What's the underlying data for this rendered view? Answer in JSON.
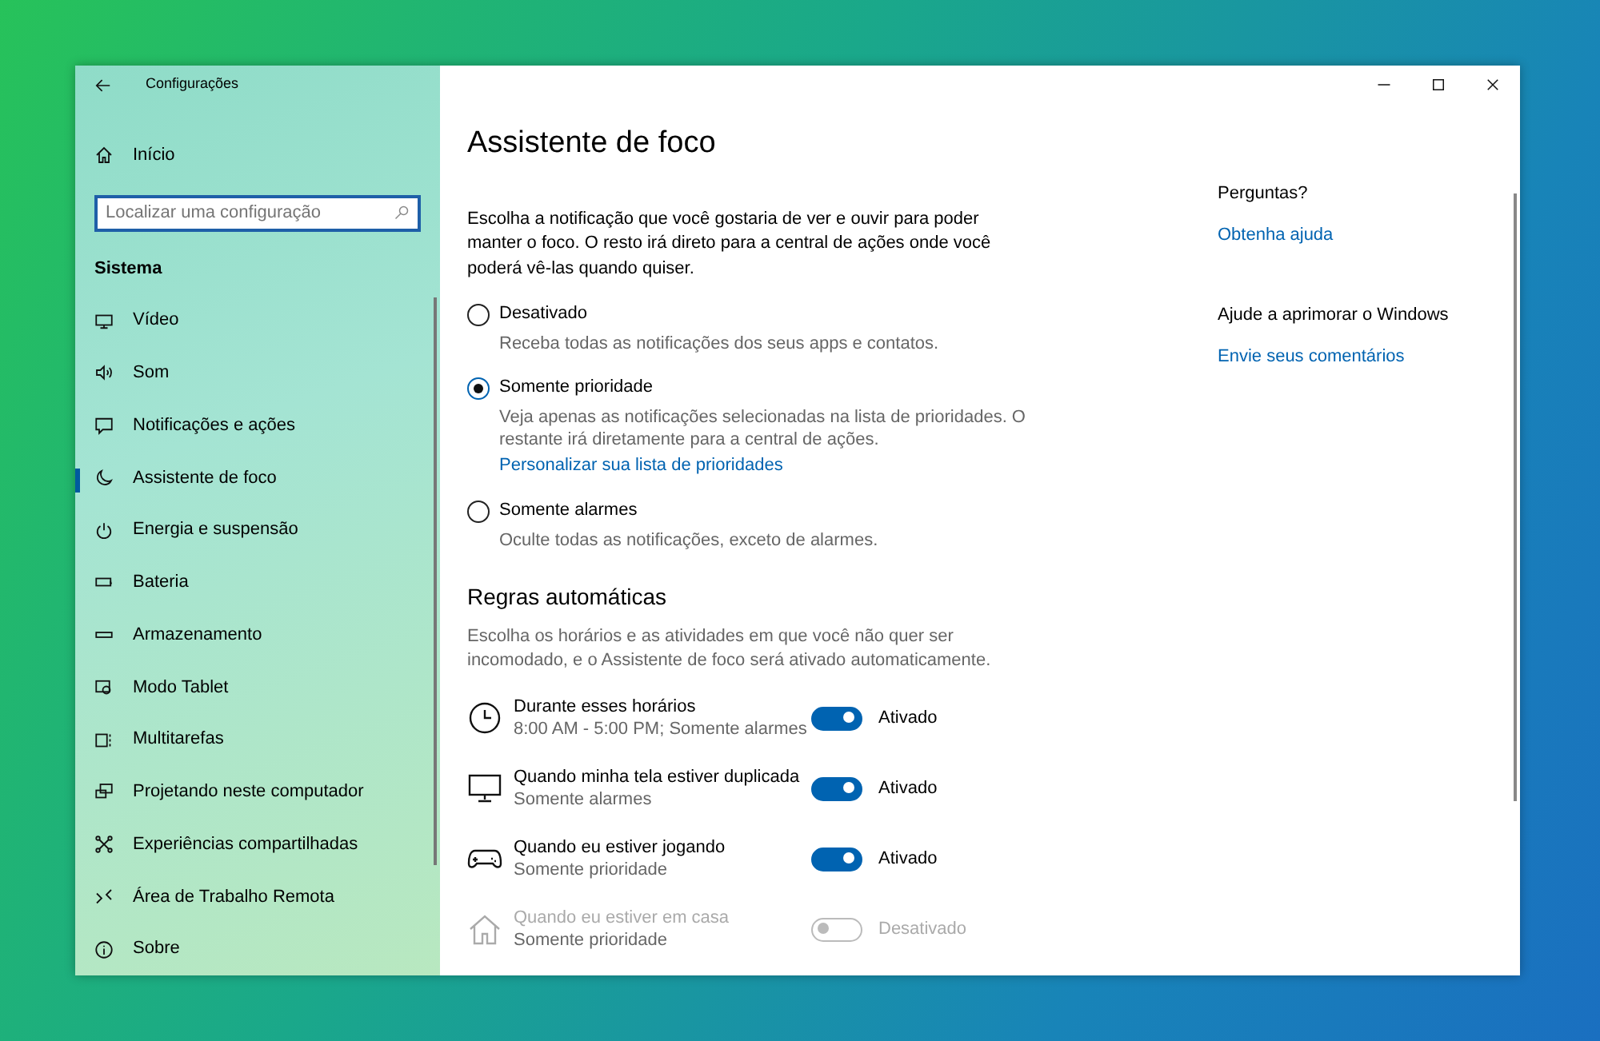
{
  "window": {
    "title": "Configurações"
  },
  "sidebar": {
    "home": "Início",
    "search": {
      "placeholder": "Localizar uma configuração"
    },
    "section": "Sistema",
    "items": [
      {
        "label": "Vídeo",
        "selected": false
      },
      {
        "label": "Som",
        "selected": false
      },
      {
        "label": "Notificações e ações",
        "selected": false
      },
      {
        "label": "Assistente de foco",
        "selected": true
      },
      {
        "label": "Energia e suspensão",
        "selected": false
      },
      {
        "label": "Bateria",
        "selected": false
      },
      {
        "label": "Armazenamento",
        "selected": false
      },
      {
        "label": "Modo Tablet",
        "selected": false
      },
      {
        "label": "Multitarefas",
        "selected": false
      },
      {
        "label": "Projetando neste computador",
        "selected": false
      },
      {
        "label": "Experiências compartilhadas",
        "selected": false
      },
      {
        "label": "Área de Trabalho Remota",
        "selected": false
      },
      {
        "label": "Sobre",
        "selected": false
      }
    ]
  },
  "page": {
    "title": "Assistente de foco",
    "intro": "Escolha a notificação que você gostaria de ver e ouvir para poder manter o foco. O resto irá direto para a central de ações onde você poderá vê-las quando quiser.",
    "options": [
      {
        "label": "Desativado",
        "description": "Receba todas as notificações dos seus apps e contatos.",
        "selected": false
      },
      {
        "label": "Somente prioridade",
        "description": "Veja apenas as notificações selecionadas na lista de prioridades. O restante irá diretamente para a central de ações.",
        "link": "Personalizar sua lista de prioridades",
        "selected": true
      },
      {
        "label": "Somente alarmes",
        "description": "Oculte todas as notificações, exceto de alarmes.",
        "selected": false
      }
    ],
    "rules_title": "Regras automáticas",
    "rules_intro": "Escolha os horários e as atividades em que você não quer ser incomodado, e o Assistente de foco será ativado automaticamente.",
    "rules": [
      {
        "title": "Durante esses horários",
        "subtitle": "8:00 AM - 5:00 PM; Somente alarmes",
        "on": true,
        "status": "Ativado",
        "disabled": false
      },
      {
        "title": "Quando minha tela estiver duplicada",
        "subtitle": "Somente alarmes",
        "on": true,
        "status": "Ativado",
        "disabled": false
      },
      {
        "title": "Quando eu estiver jogando",
        "subtitle": "Somente prioridade",
        "on": true,
        "status": "Ativado",
        "disabled": false
      },
      {
        "title": "Quando eu estiver em casa",
        "subtitle": "Somente prioridade",
        "on": false,
        "status": "Desativado",
        "disabled": true
      }
    ]
  },
  "aside": [
    {
      "heading": "Perguntas?",
      "link": "Obtenha ajuda"
    },
    {
      "heading": "Ajude a aprimorar o Windows",
      "link": "Envie seus comentários"
    }
  ]
}
